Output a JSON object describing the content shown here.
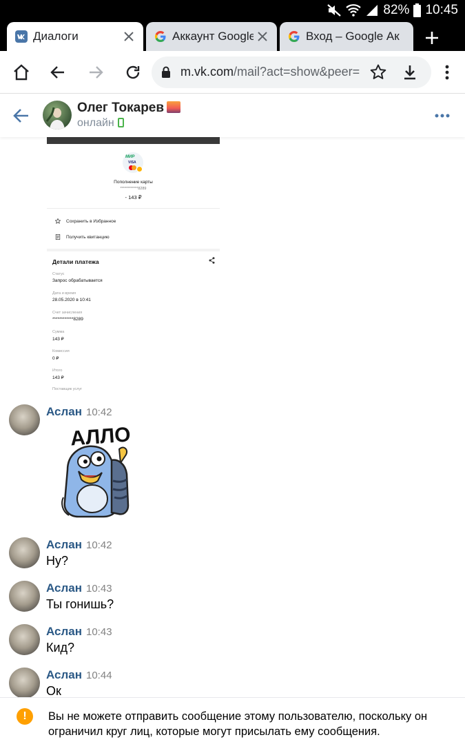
{
  "status_bar": {
    "battery": "82%",
    "time": "10:45"
  },
  "tabs": [
    {
      "title": "Диалоги",
      "favicon": "vk-icon",
      "active": true
    },
    {
      "title": "Аккаунт Google",
      "favicon": "google-icon",
      "active": false
    },
    {
      "title": "Вход – Google Ак",
      "favicon": "google-icon",
      "active": false
    }
  ],
  "address_bar": {
    "url_host": "m.vk.com",
    "url_path": "/mail?act=show&peer="
  },
  "chat_header": {
    "name": "Олег Токарев",
    "status": "онлайн"
  },
  "payment_screenshot": {
    "card_brand_1": "МИР",
    "card_brand_2": "VISA",
    "operation": "Пополнение карты",
    "masked_card": "************8289",
    "amount_main": "- 143 ₽",
    "action_save": "Сохранить в Избранное",
    "action_receipt": "Получить квитанцию",
    "details_title": "Детали платежа",
    "status_label": "Статус",
    "status_value": "Запрос обрабатывается",
    "date_label": "Дата и время",
    "date_value": "28.05.2020 в 10:41",
    "account_label": "Счет зачисления",
    "account_value": "************8289",
    "sum_label": "Сумма",
    "sum_value": "143 ₽",
    "fee_label": "Комиссия",
    "fee_value": "0 ₽",
    "total_label": "Итого",
    "total_value": "143 ₽",
    "provider_label": "Поставщик услуг"
  },
  "messages": [
    {
      "author": "Аслан",
      "time": "10:42",
      "sticker_text": "АЛЛО"
    },
    {
      "author": "Аслан",
      "time": "10:42",
      "text": "Ну?"
    },
    {
      "author": "Аслан",
      "time": "10:43",
      "text": "Ты гонишь?"
    },
    {
      "author": "Аслан",
      "time": "10:43",
      "text": "Кид?"
    },
    {
      "author": "Аслан",
      "time": "10:44",
      "text": "Ок"
    }
  ],
  "banner": {
    "text": "Вы не можете отправить сообщение этому пользователю, поскольку он ограничил круг лиц, которые могут присылать ему сообщения."
  },
  "colors": {
    "vk_blue": "#2a5885",
    "link_blue": "#4a76a8",
    "warning": "#ffa000",
    "online_green": "#4bb34b"
  }
}
